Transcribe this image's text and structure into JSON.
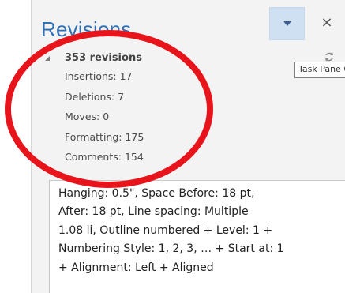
{
  "pane": {
    "title": "Revisions",
    "close_glyph": "×",
    "options_icon": "chevron-down-icon",
    "refresh_icon": "refresh-icon",
    "tooltip": "Task Pane Op"
  },
  "summary": {
    "header": "353 revisions",
    "rows": [
      "Insertions: 17",
      "Deletions: 7",
      "Moves: 0",
      "Formatting: 175",
      "Comments: 154"
    ]
  },
  "detail": {
    "lines": [
      "Hanging:  0.5\", Space Before:  18 pt,",
      "After:  18 pt, Line spacing:  Multiple",
      "1.08 li, Outline numbered + Level: 1 +",
      "Numbering Style: 1, 2, 3, … + Start at: 1",
      "+ Alignment: Left + Aligned"
    ]
  },
  "colors": {
    "title": "#2f6fb4",
    "highlight_button": "#cfe0f3",
    "annotation": "#e8141b"
  }
}
